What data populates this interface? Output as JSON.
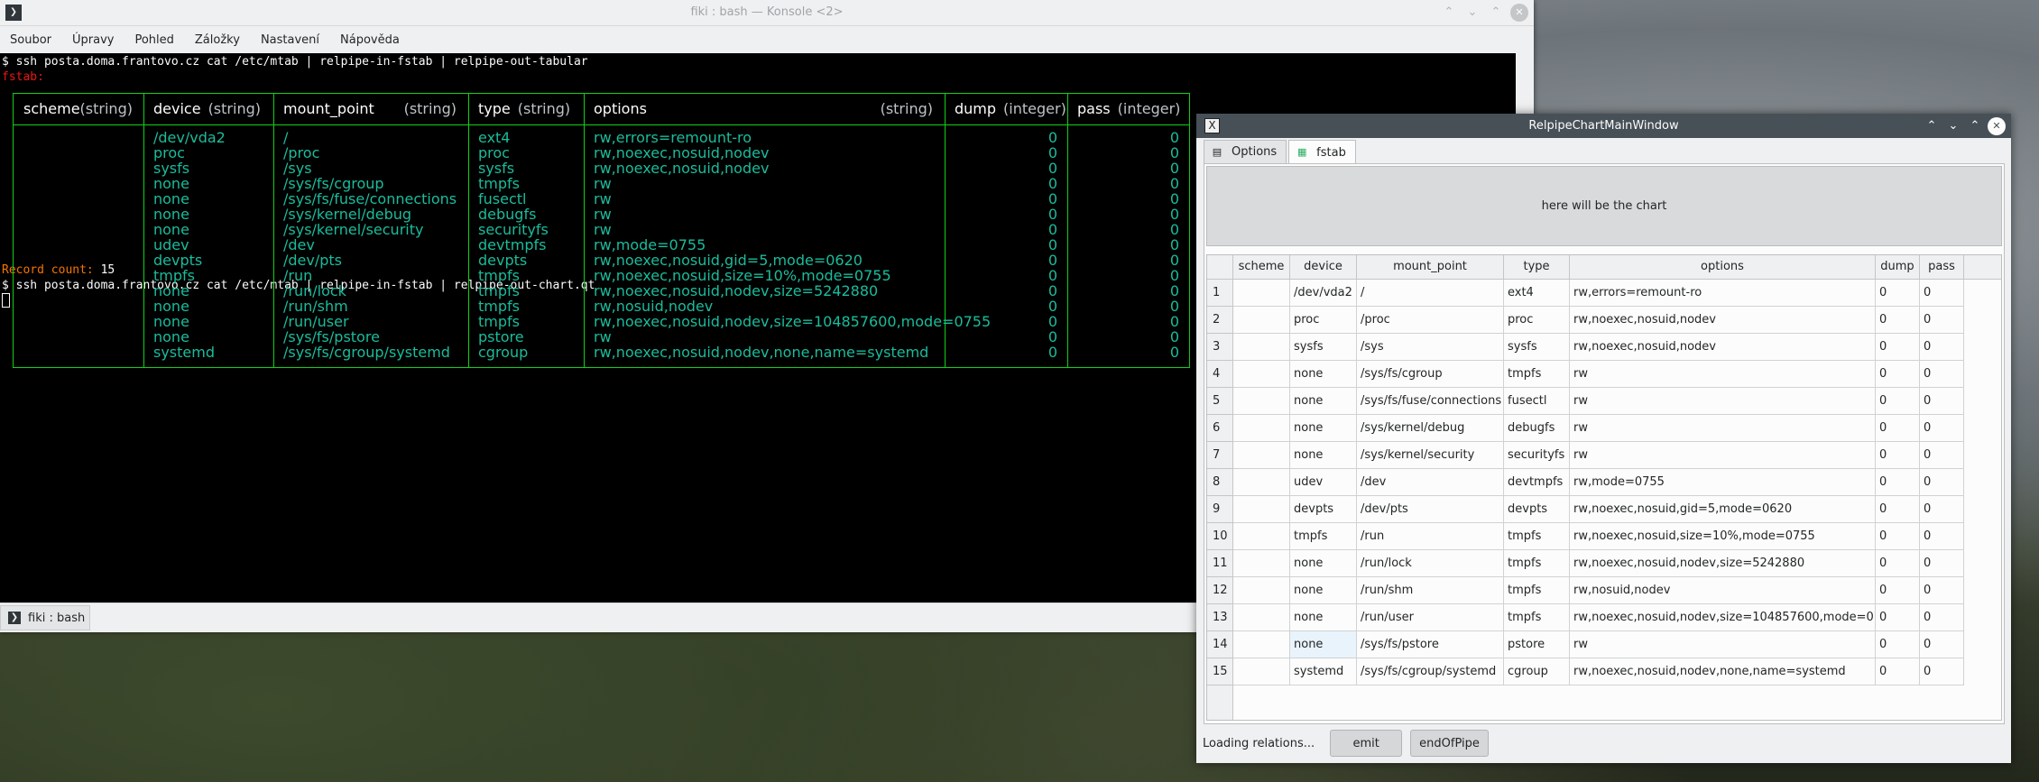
{
  "konsole": {
    "title": "fiki : bash — Konsole <2>",
    "menu": [
      "Soubor",
      "Úpravy",
      "Pohled",
      "Záložky",
      "Nastavení",
      "Nápověda"
    ],
    "command1": "$ ssh posta.doma.frantovo.cz cat /etc/mtab | relpipe-in-fstab | relpipe-out-tabular",
    "relation_name": "fstab:",
    "headers": [
      {
        "name": "scheme",
        "type": "(string)"
      },
      {
        "name": "device",
        "type": "(string)"
      },
      {
        "name": "mount_point",
        "type": "(string)"
      },
      {
        "name": "type",
        "type": "(string)"
      },
      {
        "name": "options",
        "type": "(string)"
      },
      {
        "name": "dump",
        "type": "(integer)"
      },
      {
        "name": "pass",
        "type": "(integer)"
      }
    ],
    "record_count_label": "Record count:",
    "record_count_value": "15",
    "command2": "$ ssh posta.doma.frantovo.cz cat /etc/mtab | relpipe-in-fstab | relpipe-out-chart.qt",
    "tab_label": "fiki : bash"
  },
  "rows": [
    {
      "scheme": "",
      "device": "/dev/vda2",
      "mount_point": "/",
      "type": "ext4",
      "options": "rw,errors=remount-ro",
      "dump": "0",
      "pass": "0"
    },
    {
      "scheme": "",
      "device": "proc",
      "mount_point": "/proc",
      "type": "proc",
      "options": "rw,noexec,nosuid,nodev",
      "dump": "0",
      "pass": "0"
    },
    {
      "scheme": "",
      "device": "sysfs",
      "mount_point": "/sys",
      "type": "sysfs",
      "options": "rw,noexec,nosuid,nodev",
      "dump": "0",
      "pass": "0"
    },
    {
      "scheme": "",
      "device": "none",
      "mount_point": "/sys/fs/cgroup",
      "type": "tmpfs",
      "options": "rw",
      "dump": "0",
      "pass": "0"
    },
    {
      "scheme": "",
      "device": "none",
      "mount_point": "/sys/fs/fuse/connections",
      "type": "fusectl",
      "options": "rw",
      "dump": "0",
      "pass": "0"
    },
    {
      "scheme": "",
      "device": "none",
      "mount_point": "/sys/kernel/debug",
      "type": "debugfs",
      "options": "rw",
      "dump": "0",
      "pass": "0"
    },
    {
      "scheme": "",
      "device": "none",
      "mount_point": "/sys/kernel/security",
      "type": "securityfs",
      "options": "rw",
      "dump": "0",
      "pass": "0"
    },
    {
      "scheme": "",
      "device": "udev",
      "mount_point": "/dev",
      "type": "devtmpfs",
      "options": "rw,mode=0755",
      "dump": "0",
      "pass": "0"
    },
    {
      "scheme": "",
      "device": "devpts",
      "mount_point": "/dev/pts",
      "type": "devpts",
      "options": "rw,noexec,nosuid,gid=5,mode=0620",
      "dump": "0",
      "pass": "0"
    },
    {
      "scheme": "",
      "device": "tmpfs",
      "mount_point": "/run",
      "type": "tmpfs",
      "options": "rw,noexec,nosuid,size=10%,mode=0755",
      "dump": "0",
      "pass": "0"
    },
    {
      "scheme": "",
      "device": "none",
      "mount_point": "/run/lock",
      "type": "tmpfs",
      "options": "rw,noexec,nosuid,nodev,size=5242880",
      "dump": "0",
      "pass": "0"
    },
    {
      "scheme": "",
      "device": "none",
      "mount_point": "/run/shm",
      "type": "tmpfs",
      "options": "rw,nosuid,nodev",
      "dump": "0",
      "pass": "0"
    },
    {
      "scheme": "",
      "device": "none",
      "mount_point": "/run/user",
      "type": "tmpfs",
      "options": "rw,noexec,nosuid,nodev,size=104857600,mode=0755",
      "dump": "0",
      "pass": "0"
    },
    {
      "scheme": "",
      "device": "none",
      "mount_point": "/sys/fs/pstore",
      "type": "pstore",
      "options": "rw",
      "dump": "0",
      "pass": "0"
    },
    {
      "scheme": "",
      "device": "systemd",
      "mount_point": "/sys/fs/cgroup/systemd",
      "type": "cgroup",
      "options": "rw,noexec,nosuid,nodev,none,name=systemd",
      "dump": "0",
      "pass": "0"
    }
  ],
  "chart_window": {
    "title": "RelpipeChartMainWindow",
    "tabs": [
      "Options",
      "fstab"
    ],
    "active_tab": "fstab",
    "chart_placeholder": "here will be the chart",
    "columns": [
      "scheme",
      "device",
      "mount_point",
      "type",
      "options",
      "dump",
      "pass"
    ],
    "selected_row": 14,
    "selected_column": "device",
    "status_text": "Loading relations...",
    "emit_label": "emit",
    "end_label": "endOfPipe"
  },
  "colors": {
    "terminal_bg": "#000000",
    "terminal_text": "#fcfcfc",
    "data_text": "#1abc9c",
    "table_border": "#11d116",
    "relation_name": "#ed1515",
    "record_count": "#f67400",
    "chart_titlebar": "#475057"
  }
}
